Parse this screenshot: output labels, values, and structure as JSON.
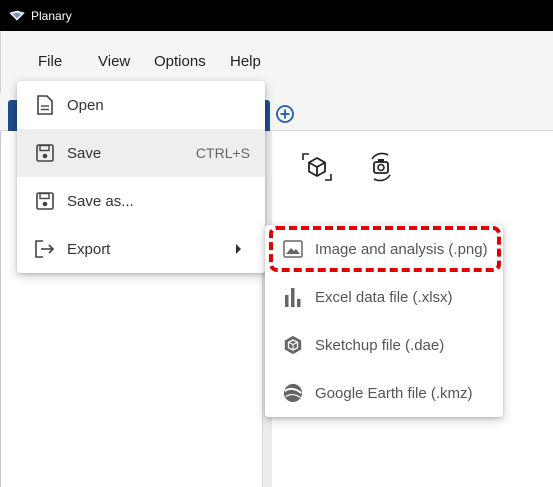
{
  "window": {
    "title": "Planary",
    "logo_icon": "planary-logo-icon"
  },
  "menubar": {
    "items": [
      {
        "label": "File"
      },
      {
        "label": "View"
      },
      {
        "label": "Options"
      },
      {
        "label": "Help"
      }
    ]
  },
  "tabs": {
    "add_icon": "plus-circle-icon"
  },
  "toolbar": {
    "icons": [
      "3d-view-icon",
      "rotate-camera-icon"
    ]
  },
  "file_menu": {
    "items": [
      {
        "label": "Open",
        "icon": "document-icon",
        "shortcut": ""
      },
      {
        "label": "Save",
        "icon": "floppy-disk-icon",
        "shortcut": "CTRL+S"
      },
      {
        "label": "Save as...",
        "icon": "floppy-disk-icon",
        "shortcut": ""
      },
      {
        "label": "Export",
        "icon": "export-arrow-icon",
        "shortcut": ""
      }
    ]
  },
  "export_menu": {
    "items": [
      {
        "label": "Image and analysis (.png)",
        "icon": "image-icon"
      },
      {
        "label": "Excel data file (.xlsx)",
        "icon": "bar-chart-icon"
      },
      {
        "label": "Sketchup file (.dae)",
        "icon": "sketchup-icon"
      },
      {
        "label": "Google Earth file (.kmz)",
        "icon": "globe-icon"
      }
    ]
  },
  "colors": {
    "titlebar": "#000000",
    "tab_active": "#1f4e8c",
    "accent": "#1f5fae",
    "highlight": "#e00000"
  }
}
